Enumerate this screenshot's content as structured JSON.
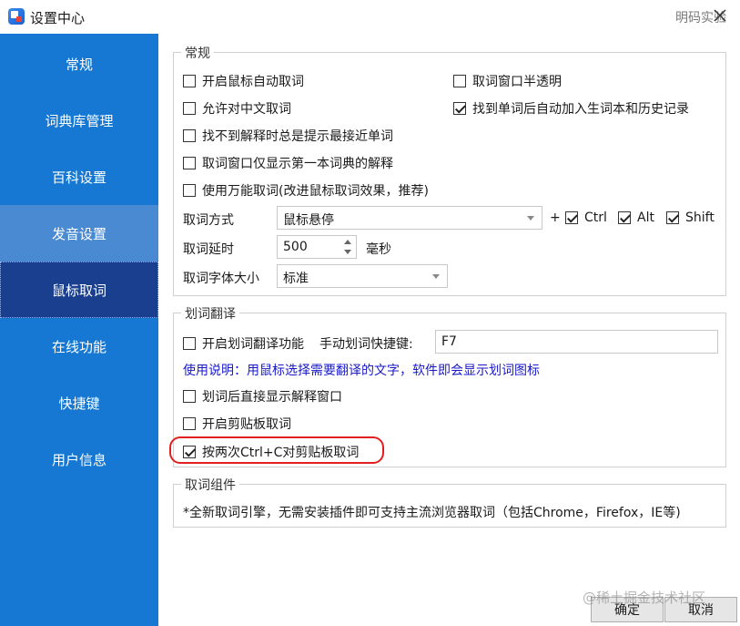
{
  "window": {
    "title": "设置中心",
    "brand": "明码实验",
    "accent": "#1678d2"
  },
  "sidebar": {
    "items": [
      {
        "label": "常规"
      },
      {
        "label": "词典库管理"
      },
      {
        "label": "百科设置"
      },
      {
        "label": "发音设置"
      },
      {
        "label": "鼠标取词"
      },
      {
        "label": "在线功能"
      },
      {
        "label": "快捷键"
      },
      {
        "label": "用户信息"
      }
    ]
  },
  "general": {
    "title": "常规",
    "options": [
      {
        "label": "开启鼠标自动取词",
        "checked": false
      },
      {
        "label": "取词窗口半透明",
        "checked": false
      },
      {
        "label": "允许对中文取词",
        "checked": false
      },
      {
        "label": "找到单词后自动加入生词本和历史记录",
        "checked": true
      },
      {
        "label": "找不到解释时总是提示最接近单词",
        "checked": false
      },
      {
        "label": "取词窗口仅显示第一本词典的解释",
        "checked": false
      },
      {
        "label": "使用万能取词(改进鼠标取词效果，推荐)",
        "checked": false
      }
    ],
    "mode_label": "取词方式",
    "mode_value": "鼠标悬停",
    "plus": "+",
    "modifiers": [
      {
        "label": "Ctrl",
        "checked": true
      },
      {
        "label": "Alt",
        "checked": true
      },
      {
        "label": "Shift",
        "checked": true
      }
    ],
    "delay_label": "取词延时",
    "delay_value": "500",
    "delay_unit": "毫秒",
    "font_label": "取词字体大小",
    "font_value": "标准"
  },
  "selection": {
    "title": "划词翻译",
    "enable_label": "开启划词翻译功能",
    "enable_checked": false,
    "hotkey_label": "手动划词快捷键:",
    "hotkey_value": "F7",
    "hint": "使用说明：用鼠标选择需要翻译的文字，软件即会显示划词图标",
    "direct_label": "划词后直接显示解释窗口",
    "direct_checked": false,
    "clipboard_label": "开启剪贴板取词",
    "clipboard_checked": false,
    "double_copy_label": "按两次Ctrl+C对剪贴板取词",
    "double_copy_checked": true
  },
  "component": {
    "title": "取词组件",
    "text": "*全新取词引擎，无需安装插件即可支持主流浏览器取词（包括Chrome，Firefox，IE等)"
  },
  "footer": {
    "ok_label": "确定",
    "cancel_label": "取消",
    "watermark": "@稀土掘金技术社区"
  }
}
